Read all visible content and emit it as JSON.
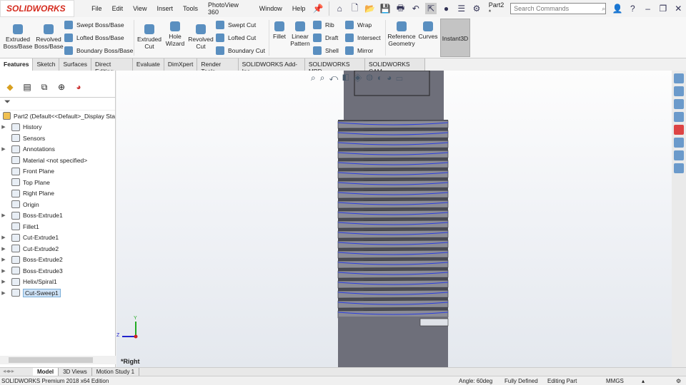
{
  "app": {
    "logo": "SOLIDWORKS",
    "doc_title": "Part2 *",
    "search_placeholder": "Search Commands"
  },
  "menu": [
    "File",
    "Edit",
    "View",
    "Insert",
    "Tools",
    "PhotoView 360",
    "Window",
    "Help"
  ],
  "ribbon": {
    "extruded_boss": "Extruded Boss/Base",
    "revolved_boss": "Revolved Boss/Base",
    "swept_boss": "Swept Boss/Base",
    "lofted_boss": "Lofted Boss/Base",
    "boundary_boss": "Boundary Boss/Base",
    "extruded_cut": "Extruded Cut",
    "hole_wizard": "Hole Wizard",
    "revolved_cut": "Revolved Cut",
    "swept_cut": "Swept Cut",
    "lofted_cut": "Lofted Cut",
    "boundary_cut": "Boundary Cut",
    "fillet": "Fillet",
    "linear_pattern": "Linear Pattern",
    "rib": "Rib",
    "draft": "Draft",
    "shell": "Shell",
    "wrap": "Wrap",
    "intersect": "Intersect",
    "mirror": "Mirror",
    "reference_geometry": "Reference Geometry",
    "curves": "Curves",
    "instant3d": "Instant3D"
  },
  "tabs": [
    "Features",
    "Sketch",
    "Surfaces",
    "Direct Editing",
    "Evaluate",
    "DimXpert",
    "Render Tools",
    "SOLIDWORKS Add-Ins",
    "SOLIDWORKS MBD",
    "SOLIDWORKS CAM"
  ],
  "tree": {
    "root": "Part2  (Default<<Default>_Display Sta",
    "items": [
      {
        "label": "History",
        "exp": true
      },
      {
        "label": "Sensors",
        "exp": false
      },
      {
        "label": "Annotations",
        "exp": true
      },
      {
        "label": "Material <not specified>",
        "exp": false
      },
      {
        "label": "Front Plane",
        "exp": false
      },
      {
        "label": "Top Plane",
        "exp": false
      },
      {
        "label": "Right Plane",
        "exp": false
      },
      {
        "label": "Origin",
        "exp": false
      },
      {
        "label": "Boss-Extrude1",
        "exp": true
      },
      {
        "label": "Fillet1",
        "exp": false
      },
      {
        "label": "Cut-Extrude1",
        "exp": true
      },
      {
        "label": "Cut-Extrude2",
        "exp": true
      },
      {
        "label": "Boss-Extrude2",
        "exp": true
      },
      {
        "label": "Boss-Extrude3",
        "exp": true
      },
      {
        "label": "Helix/Spiral1",
        "exp": true
      },
      {
        "label": "Cut-Sweep1",
        "exp": true,
        "selected": true
      }
    ]
  },
  "viewport": {
    "view_label": "*Right",
    "axis_y": "Y",
    "axis_z": "Z"
  },
  "bottom_tabs": [
    "Model",
    "3D Views",
    "Motion Study 1"
  ],
  "status": {
    "edition": "SOLIDWORKS Premium 2018 x64 Edition",
    "angle": "Angle: 60deg",
    "defined": "Fully Defined",
    "editing": "Editing Part",
    "units": "MMGS"
  }
}
